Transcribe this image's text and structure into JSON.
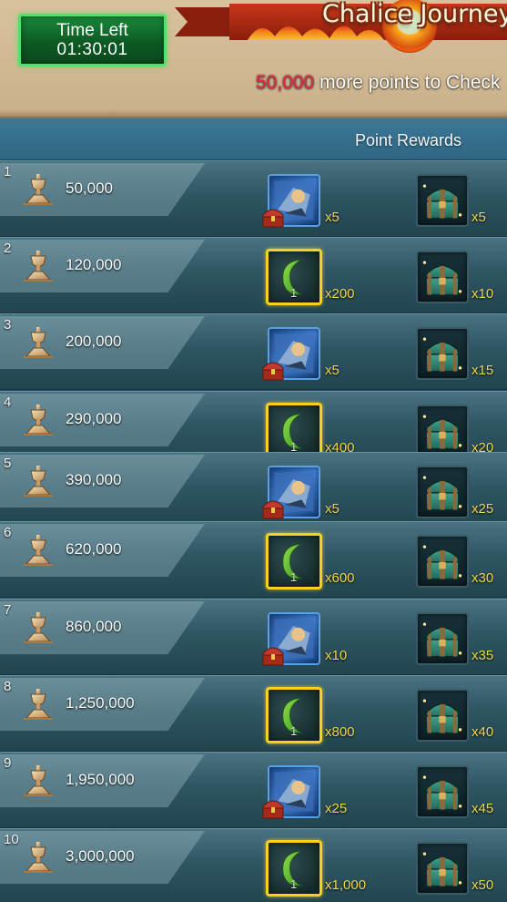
{
  "header": {
    "timer_label": "Time Left",
    "timer_value": "01:30:01",
    "event_title": "Chalice Journey",
    "points_needed": "50,000",
    "points_text": " more points to Check"
  },
  "columns": {
    "point_rewards": "Point Rewards"
  },
  "rewards": [
    {
      "rank": "1",
      "points": "50,000",
      "reward_a": {
        "icon": "hero-card-icon",
        "qty": "x5"
      },
      "reward_b": {
        "icon": "treasure-chest-icon",
        "qty": "x5"
      }
    },
    {
      "rank": "2",
      "points": "120,000",
      "reward_a": {
        "icon": "moon-shard-icon",
        "qty": "x200",
        "level": "1"
      },
      "reward_b": {
        "icon": "treasure-chest-icon",
        "qty": "x10"
      }
    },
    {
      "rank": "3",
      "points": "200,000",
      "reward_a": {
        "icon": "hero-card-icon",
        "qty": "x5"
      },
      "reward_b": {
        "icon": "treasure-chest-icon",
        "qty": "x15"
      }
    },
    {
      "rank": "4",
      "points": "290,000",
      "reward_a": {
        "icon": "moon-shard-icon",
        "qty": "x400",
        "level": "1"
      },
      "reward_b": {
        "icon": "treasure-chest-icon",
        "qty": "x20"
      }
    },
    {
      "rank": "5",
      "points": "390,000",
      "reward_a": {
        "icon": "hero-card-icon",
        "qty": "x5"
      },
      "reward_b": {
        "icon": "treasure-chest-icon",
        "qty": "x25"
      }
    },
    {
      "rank": "6",
      "points": "620,000",
      "reward_a": {
        "icon": "moon-shard-icon",
        "qty": "x600",
        "level": "1"
      },
      "reward_b": {
        "icon": "treasure-chest-icon",
        "qty": "x30"
      }
    },
    {
      "rank": "7",
      "points": "860,000",
      "reward_a": {
        "icon": "hero-card-icon",
        "qty": "x10"
      },
      "reward_b": {
        "icon": "treasure-chest-icon",
        "qty": "x35"
      }
    },
    {
      "rank": "8",
      "points": "1,250,000",
      "reward_a": {
        "icon": "moon-shard-icon",
        "qty": "x800",
        "level": "1"
      },
      "reward_b": {
        "icon": "treasure-chest-icon",
        "qty": "x40"
      }
    },
    {
      "rank": "9",
      "points": "1,950,000",
      "reward_a": {
        "icon": "hero-card-icon",
        "qty": "x25"
      },
      "reward_b": {
        "icon": "treasure-chest-icon",
        "qty": "x45"
      }
    },
    {
      "rank": "10",
      "points": "3,000,000",
      "reward_a": {
        "icon": "moon-shard-icon",
        "qty": "x1,000",
        "level": "1"
      },
      "reward_b": {
        "icon": "treasure-chest-icon",
        "qty": "x50"
      }
    }
  ],
  "colors": {
    "timer_green": "#1a8a3a",
    "timer_border": "#52e06a",
    "points_red": "#e8284a",
    "moon_frame_gold": "#f7d21c",
    "quantity_yellow": "#f0d64a"
  }
}
